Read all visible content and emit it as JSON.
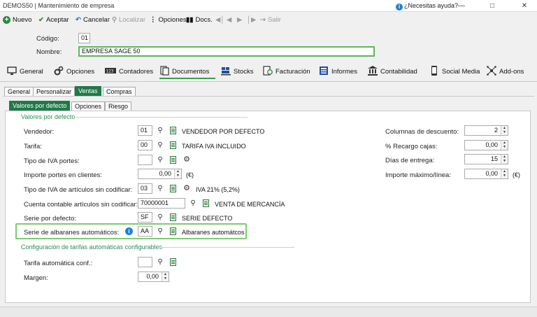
{
  "window": {
    "title": "DEMOS50 | Mantenimiento de empresa",
    "help": "¿Necesitas ayuda?"
  },
  "toolbar": {
    "nuevo": "Nuevo",
    "aceptar": "Aceptar",
    "cancelar": "Cancelar",
    "localizar": "Localizar",
    "opciones": "Opciones",
    "docs": "Docs.",
    "salir": "Salir"
  },
  "header": {
    "codigo_label": "Código:",
    "codigo_value": "01",
    "nombre_label": "Nombre:",
    "nombre_value": "EMPRESA SAGE 50"
  },
  "main_tabs": [
    {
      "label": "General",
      "icon": "monitor-icon"
    },
    {
      "label": "Opciones",
      "icon": "gears-icon"
    },
    {
      "label": "Contadores",
      "icon": "counter-icon"
    },
    {
      "label": "Documentos",
      "icon": "documents-icon"
    },
    {
      "label": "Stocks",
      "icon": "forklift-icon"
    },
    {
      "label": "Facturación",
      "icon": "billing-icon"
    },
    {
      "label": "Informes",
      "icon": "reports-icon"
    },
    {
      "label": "Contabilidad",
      "icon": "bank-icon"
    },
    {
      "label": "Social Media",
      "icon": "phone-icon"
    },
    {
      "label": "Add-ons",
      "icon": "network-icon"
    }
  ],
  "sub_tabs": [
    "General",
    "Personalizar",
    "Ventas",
    "Compras"
  ],
  "sub_sub_tabs": [
    "Valores por defecto",
    "Opciones",
    "Riesgo"
  ],
  "section1": "Valores por defecto",
  "section2": "Configuración de tarifas automáticas configurables",
  "fields": {
    "vendedor_label": "Vendedor:",
    "vendedor_value": "01",
    "vendedor_desc": "VENDEDOR POR DEFECTO",
    "tarifa_label": "Tarifa:",
    "tarifa_value": "00",
    "tarifa_desc": "TARIFA IVA INCLUIDO",
    "tipo_iva_portes_label": "Tipo de IVA portes:",
    "tipo_iva_portes_value": "",
    "importe_portes_label": "Importe portes en clientes:",
    "importe_portes_value": "0,00",
    "importe_portes_unit": "(€)",
    "tipo_iva_art_label": "Tipo de IVA de artículos sin codificar:",
    "tipo_iva_art_value": "03",
    "tipo_iva_art_desc": "IVA 21% (5,2%)",
    "cuenta_label": "Cuenta contable artículos sin codificar:",
    "cuenta_value": "70000001",
    "cuenta_desc": "VENTA DE MERCANCÍA",
    "serie_label": "Serie por defecto:",
    "serie_value": "SF",
    "serie_desc": "SERIE DEFECTO",
    "serie_alb_label": "Serie de albaranes automáticos:",
    "serie_alb_value": "AA",
    "serie_alb_desc": "Albaranes automátcos",
    "tarifa_auto_label": "Tarifa automática conf.:",
    "tarifa_auto_value": "",
    "margen_label": "Margen:",
    "margen_value": "0,00"
  },
  "right_fields": {
    "columnas_label": "Columnas de descuento:",
    "columnas_value": "2",
    "recargo_label": "% Recargo cajas:",
    "recargo_value": "0,00",
    "dias_label": "Días de entrega:",
    "dias_value": "15",
    "importe_max_label": "Importe máximo/línea:",
    "importe_max_value": "0,00",
    "importe_max_unit": "(€)"
  },
  "colors": {
    "accent_green": "#1f7a47",
    "highlight_green": "#7ccc6f",
    "info_blue": "#1f7fd8"
  }
}
